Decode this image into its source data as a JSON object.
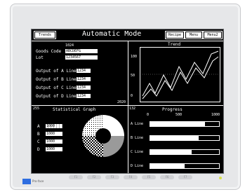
{
  "header": {
    "trends_button": "Trends",
    "title": "Automatic Mode",
    "recipe_button": "Recipe",
    "menu1_button": "Menu",
    "menu2_button": "Menu2"
  },
  "info": {
    "top_small": "1024",
    "goods_code_label": "Goods Code",
    "goods_code_value": "ABCDEFG",
    "lot_label": "Lot",
    "lot_value": "1234567",
    "line_a_label": "Output of A Line",
    "line_a_value": "1234",
    "line_b_label": "Output of B Line",
    "line_b_value": "1234",
    "line_c_label": "Output of C Line",
    "line_c_value": "1234",
    "line_d_label": "Output of D Line",
    "line_d_value": "1234",
    "footer_value": "2020"
  },
  "trend": {
    "title": "Trend",
    "y_labels": [
      "100",
      "50",
      "0"
    ]
  },
  "stats": {
    "left_label": "255",
    "title": "Statistical Graph",
    "rows": [
      {
        "label": "A",
        "value": "1000"
      },
      {
        "label": "B",
        "value": "1000"
      },
      {
        "label": "C",
        "value": "1000"
      },
      {
        "label": "D",
        "value": "1000"
      }
    ]
  },
  "progress": {
    "left_label": "132",
    "title": "Progress",
    "scale": [
      "0",
      "500",
      "1000"
    ],
    "rows": [
      {
        "label": "A Line",
        "fill": 0.8
      },
      {
        "label": "B Line",
        "fill": 0.7
      },
      {
        "label": "C Line",
        "fill": 0.6
      },
      {
        "label": "D Line",
        "fill": 0.5
      }
    ]
  },
  "bezel": {
    "brand": "Pro-face",
    "fkeys": [
      "F1",
      "F2",
      "F3",
      "F4",
      "F5",
      "F6",
      "F7"
    ]
  },
  "colors": {
    "screen_bg": "#000000",
    "fg": "#ffffff",
    "bezel": "#e6e7e9",
    "logo": "#2f6ee0",
    "led": "#d7e24a"
  }
}
